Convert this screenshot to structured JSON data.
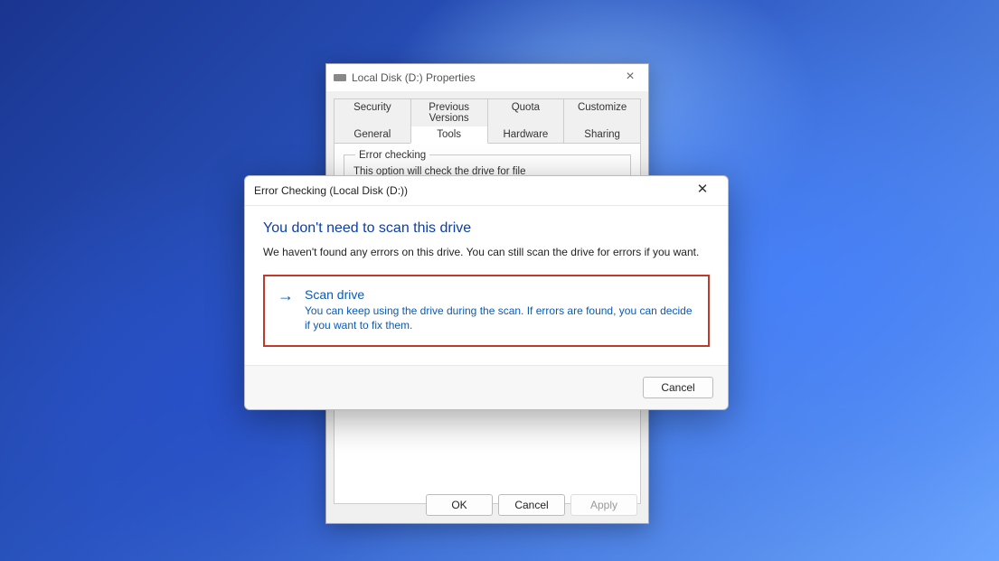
{
  "properties": {
    "title": "Local Disk (D:) Properties",
    "tabs_row1": [
      "Security",
      "Previous Versions",
      "Quota",
      "Customize"
    ],
    "tabs_row2": [
      "General",
      "Tools",
      "Hardware",
      "Sharing"
    ],
    "active_tab": "Tools",
    "error_checking": {
      "legend": "Error checking",
      "text": "This option will check the drive for file"
    },
    "buttons": {
      "ok": "OK",
      "cancel": "Cancel",
      "apply": "Apply"
    }
  },
  "error_dialog": {
    "title": "Error Checking (Local Disk (D:))",
    "headline": "You don't need to scan this drive",
    "subtext": "We haven't found any errors on this drive. You can still scan the drive for errors if you want.",
    "scan": {
      "title": "Scan drive",
      "desc": "You can keep using the drive during the scan. If errors are found, you can decide if you want to fix them."
    },
    "cancel": "Cancel"
  }
}
